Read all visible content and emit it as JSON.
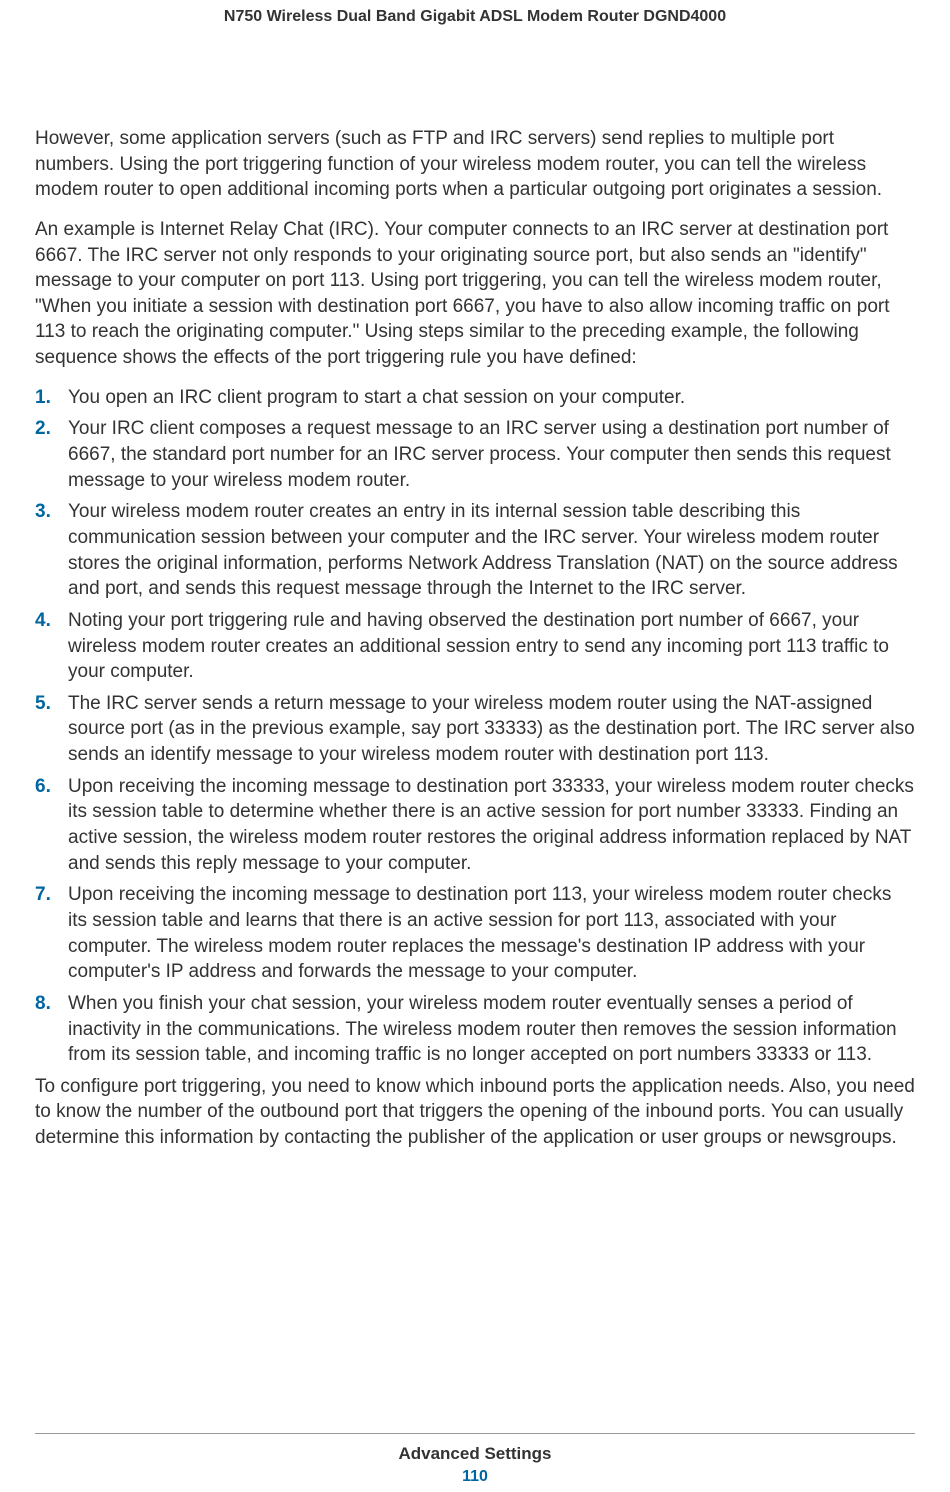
{
  "header": {
    "title": "N750 Wireless Dual Band Gigabit ADSL Modem Router DGND4000"
  },
  "body": {
    "para1": "However, some application servers (such as FTP and IRC servers) send replies to multiple port numbers. Using the port triggering function of your wireless modem router, you can tell the wireless modem router to open additional incoming ports when a particular outgoing port originates a session.",
    "para2": "An example is Internet Relay Chat (IRC). Your computer connects to an IRC server at destination port 6667. The IRC server not only responds to your originating source port, but also sends an \"identify\" message to your computer on port 113. Using port triggering, you can tell the wireless modem router, \"When you initiate a session with destination port 6667, you have to also allow incoming traffic on port 113 to reach the originating computer.\" Using steps similar to the preceding example, the following sequence shows the effects of the port triggering rule you have defined:",
    "list": [
      "You open an IRC client program to start a chat session on your computer.",
      "Your IRC client composes a request message to an IRC server using a destination port number of 6667, the standard port number for an IRC server process. Your computer then sends this request message to your wireless modem router.",
      "Your wireless modem router creates an entry in its internal session table describing this communication session between your computer and the IRC server. Your wireless modem router stores the original information, performs Network Address Translation (NAT) on the source address and port, and sends this request message through the Internet to the IRC server.",
      "Noting your port triggering rule and having observed the destination port number of 6667, your wireless modem router creates an additional session entry to send any incoming port 113 traffic to your computer.",
      "The IRC server sends a return message to your wireless modem router using the NAT-assigned source port (as in the previous example, say port 33333) as the destination port. The IRC server also sends an identify message to your wireless modem router with destination port 113.",
      "Upon receiving the incoming message to destination port 33333, your wireless modem router checks its session table to determine whether there is an active session for port number 33333. Finding an active session, the wireless modem router restores the original address information replaced by NAT and sends this reply message to your computer.",
      "Upon receiving the incoming message to destination port 113, your wireless modem router checks its session table and learns that there is an active session for port 113, associated with your computer. The wireless modem router replaces the message's destination IP address with your computer's IP address and forwards the message to your computer.",
      "When you finish your chat session, your wireless modem router eventually senses a period of inactivity in the communications. The wireless modem router then removes the session information from its session table, and incoming traffic is no longer accepted on port numbers 33333 or 113."
    ],
    "para3": "To configure port triggering, you need to know which inbound ports the application needs. Also, you need to know the number of the outbound port that triggers the opening of the inbound ports. You can usually determine this information by contacting the publisher of the application or user groups or newsgroups."
  },
  "footer": {
    "section": "Advanced Settings",
    "page": "110"
  }
}
